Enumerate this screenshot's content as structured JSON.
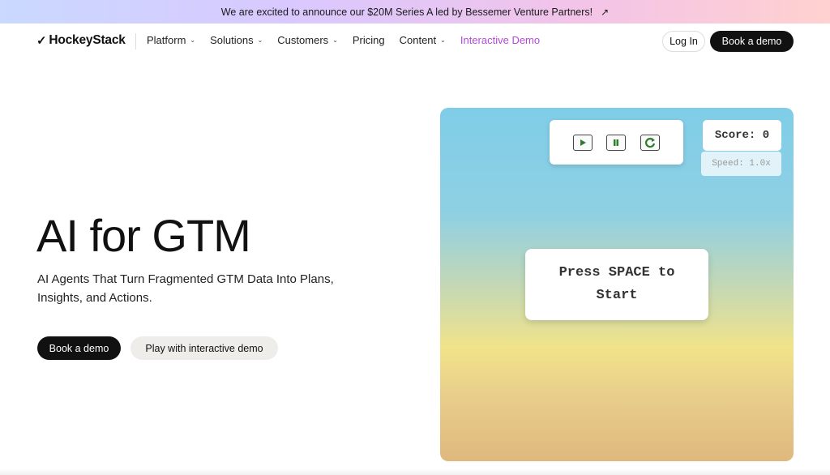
{
  "announcement": {
    "text": "We are excited to announce our $20M Series A led by Bessemer Venture Partners!",
    "arrow_icon": "↗"
  },
  "nav": {
    "logo_text": "HockeyStack",
    "logo_mark": "✓",
    "items": [
      {
        "label": "Platform",
        "has_dropdown": true
      },
      {
        "label": "Solutions",
        "has_dropdown": true
      },
      {
        "label": "Customers",
        "has_dropdown": true
      },
      {
        "label": "Pricing",
        "has_dropdown": false
      },
      {
        "label": "Content",
        "has_dropdown": true
      },
      {
        "label": "Interactive Demo",
        "has_dropdown": false
      }
    ],
    "chevron": "⌄",
    "login_label": "Log In",
    "book_label": "Book a demo",
    "accent_color": "#b24ad6"
  },
  "hero": {
    "title": "AI for GTM",
    "subtitle": "AI Agents That Turn Fragmented GTM Data Into Plans, Insights, and Actions.",
    "primary_button": "Book a demo",
    "secondary_button": "Play with interactive demo"
  },
  "game": {
    "controls": [
      {
        "name": "play-icon"
      },
      {
        "name": "pause-icon"
      },
      {
        "name": "restart-icon"
      }
    ],
    "score_text": "Score: 0",
    "speed_text": "Speed: 1.0x",
    "start_message": "Press SPACE to Start",
    "icon_color": "#2e7d32"
  }
}
